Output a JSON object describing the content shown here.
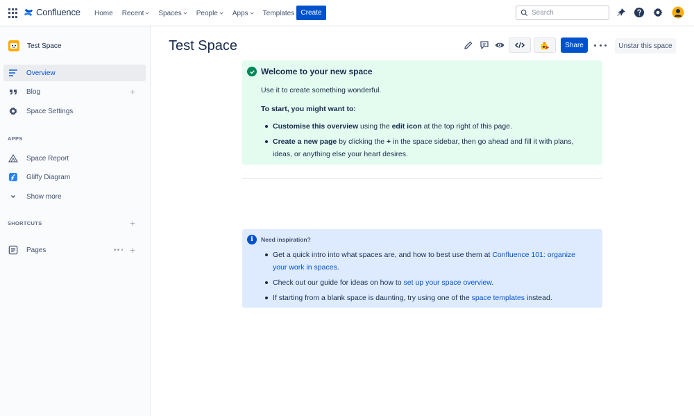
{
  "app": {
    "name": "Confluence"
  },
  "nav": {
    "home": "Home",
    "recent": "Recent",
    "spaces": "Spaces",
    "people": "People",
    "apps": "Apps",
    "templates": "Templates",
    "create": "Create"
  },
  "search": {
    "placeholder": "Search"
  },
  "sidebar": {
    "space_name": "Test Space",
    "overview": "Overview",
    "blog": "Blog",
    "space_settings": "Space Settings",
    "apps_label": "APPS",
    "space_report": "Space Report",
    "gliffy": "Gliffy Diagram",
    "show_more": "Show more",
    "shortcuts_label": "SHORTCUTS",
    "pages": "Pages"
  },
  "page": {
    "title": "Test Space",
    "share": "Share",
    "unstar": "Unstar this space"
  },
  "welcome_panel": {
    "title": "Welcome to your new space",
    "subtitle": "Use it to create something wonderful.",
    "start": "To start, you might want to:",
    "b1_strong": "Customise this overview",
    "b1_mid": " using the ",
    "b1_strong2": "edit icon",
    "b1_end": " at the top right of this page.",
    "b2_strong": "Create a new page",
    "b2_mid": " by clicking the ",
    "b2_plus": "+",
    "b2_end": " in the space sidebar, then go ahead and fill it with plans, ideas, or anything else your heart desires."
  },
  "info_panel": {
    "title": "Need inspiration?",
    "icon_glyph": "i",
    "b1_text": "Get a quick intro into what spaces are, and how to best use them at ",
    "b1_link": "Confluence 101: organize your work in spaces",
    "b1_end": ".",
    "b2_text": "Check out our guide for ideas on how to ",
    "b2_link": "set up your space overview",
    "b2_end": ".",
    "b3_text": "If starting from a blank space is daunting, try using one of the ",
    "b3_link": "space templates",
    "b3_end": " instead."
  },
  "colors": {
    "brand": "#0052cc",
    "success_bg": "#e3fcef",
    "info_bg": "#deebff",
    "success_icon": "#00875a"
  }
}
